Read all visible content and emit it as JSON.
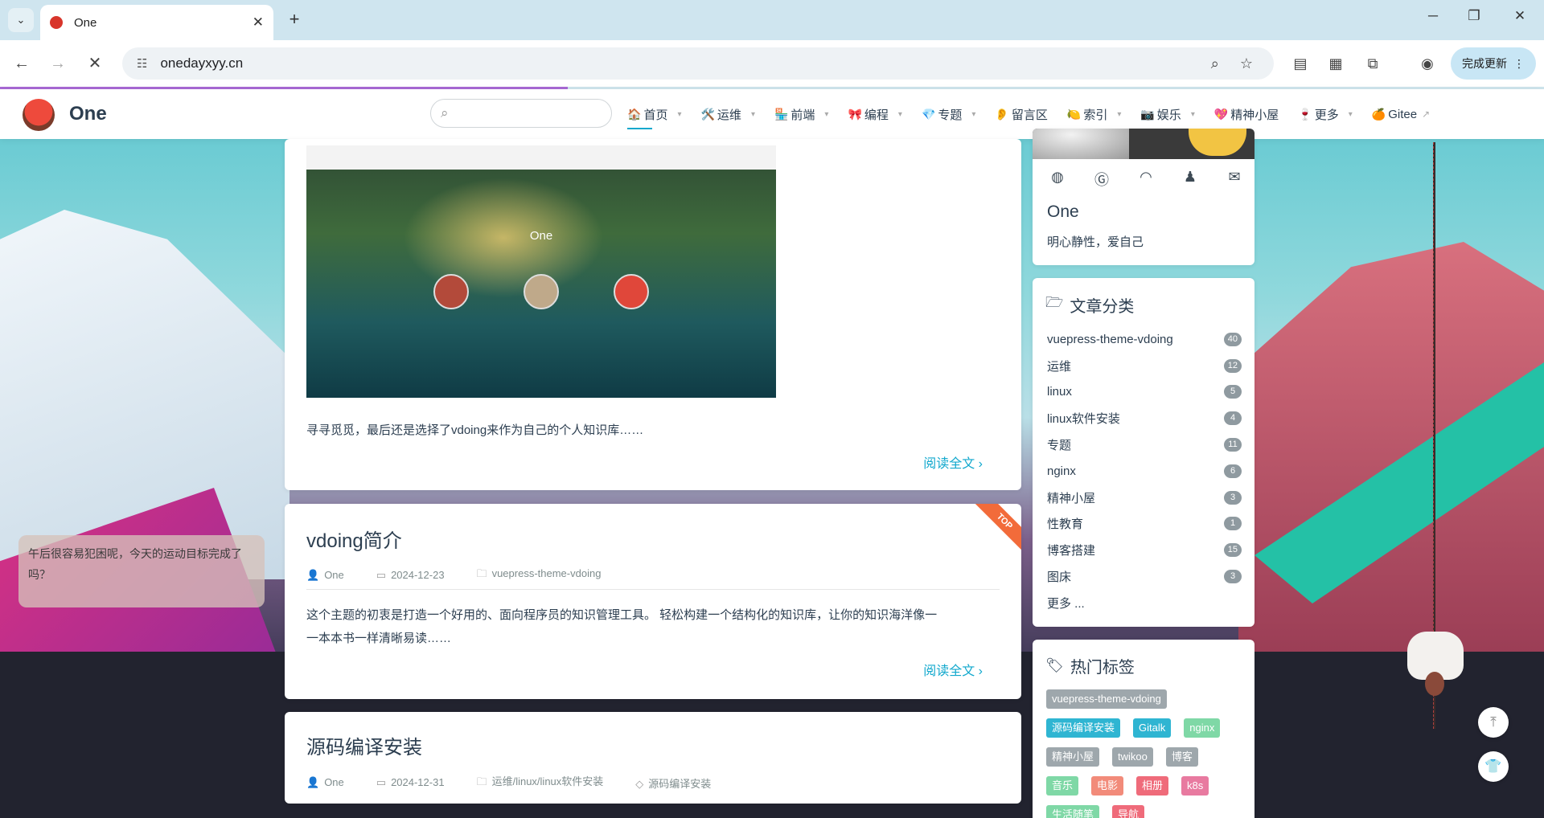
{
  "browser": {
    "tab_title": "One",
    "url": "onedayxyy.cn",
    "update_label": "完成更新"
  },
  "site": {
    "brand": "One",
    "nav": [
      {
        "emoji": "🏠",
        "label": "首页",
        "caret": "▾"
      },
      {
        "emoji": "🛠️",
        "label": "运维",
        "caret": "▾"
      },
      {
        "emoji": "🏪",
        "label": "前端",
        "caret": "▾"
      },
      {
        "emoji": "🎀",
        "label": "编程",
        "caret": "▾"
      },
      {
        "emoji": "💎",
        "label": "专题",
        "caret": "▾"
      },
      {
        "emoji": "👂",
        "label": "留言区",
        "caret": ""
      },
      {
        "emoji": "🍋",
        "label": "索引",
        "caret": "▾"
      },
      {
        "emoji": "📷",
        "label": "娱乐",
        "caret": "▾"
      },
      {
        "emoji": "💖",
        "label": "精神小屋",
        "caret": ""
      },
      {
        "emoji": "🍷",
        "label": "更多",
        "caret": "▾"
      },
      {
        "emoji": "🍊",
        "label": "Gitee",
        "caret": ""
      }
    ]
  },
  "posts": [
    {
      "screenshot_title": "One",
      "excerpt": "寻寻觅觅，最后还是选择了vdoing来作为自己的个人知识库……",
      "read_more": "阅读全文"
    },
    {
      "title": "vdoing简介",
      "author": "One",
      "date": "2024-12-23",
      "category": "vuepress-theme-vdoing",
      "excerpt_line1": "这个主题的初衷是打造一个好用的、面向程序员的知识管理工具。 轻松构建一个结构化的知识库，让你的知识海洋像一",
      "excerpt_line2": "一本本书一样清晰易读……",
      "read_more": "阅读全文",
      "badge": "TOP"
    },
    {
      "title": "源码编译安装",
      "author": "One",
      "date": "2024-12-31",
      "category": "运维/linux/linux软件安装",
      "tag": "源码编译安装"
    }
  ],
  "blogger": {
    "name": "One",
    "slogan": "明心静性，爱自己"
  },
  "categories": {
    "title": "文章分类",
    "items": [
      {
        "name": "vuepress-theme-vdoing",
        "count": "40"
      },
      {
        "name": "运维",
        "count": "12"
      },
      {
        "name": "linux",
        "count": "5"
      },
      {
        "name": "linux软件安装",
        "count": "4"
      },
      {
        "name": "专题",
        "count": "11"
      },
      {
        "name": "nginx",
        "count": "6"
      },
      {
        "name": "精神小屋",
        "count": "3"
      },
      {
        "name": "性教育",
        "count": "1"
      },
      {
        "name": "博客搭建",
        "count": "15"
      },
      {
        "name": "图床",
        "count": "3"
      }
    ],
    "more": "更多 ..."
  },
  "tags": {
    "title": "热门标签",
    "items": [
      {
        "label": "vuepress-theme-vdoing",
        "color": "#9ea7ac"
      },
      {
        "label": "源码编译安装",
        "color": "#2fb5d2"
      },
      {
        "label": "Gitalk",
        "color": "#2fb5d2"
      },
      {
        "label": "nginx",
        "color": "#7fd8a6"
      },
      {
        "label": "精神小屋",
        "color": "#9ea7ac"
      },
      {
        "label": "twikoo",
        "color": "#9ea7ac"
      },
      {
        "label": "博客",
        "color": "#9ea7ac"
      },
      {
        "label": "音乐",
        "color": "#7fd8a6"
      },
      {
        "label": "电影",
        "color": "#f28b7a"
      },
      {
        "label": "相册",
        "color": "#ef6b7a"
      },
      {
        "label": "k8s",
        "color": "#e87aa0"
      },
      {
        "label": "生活随笔",
        "color": "#7fd8a6"
      },
      {
        "label": "导航",
        "color": "#ef6b7a"
      }
    ]
  },
  "tip": {
    "text": "午后很容易犯困呢，今天的运动目标完成了吗？"
  }
}
